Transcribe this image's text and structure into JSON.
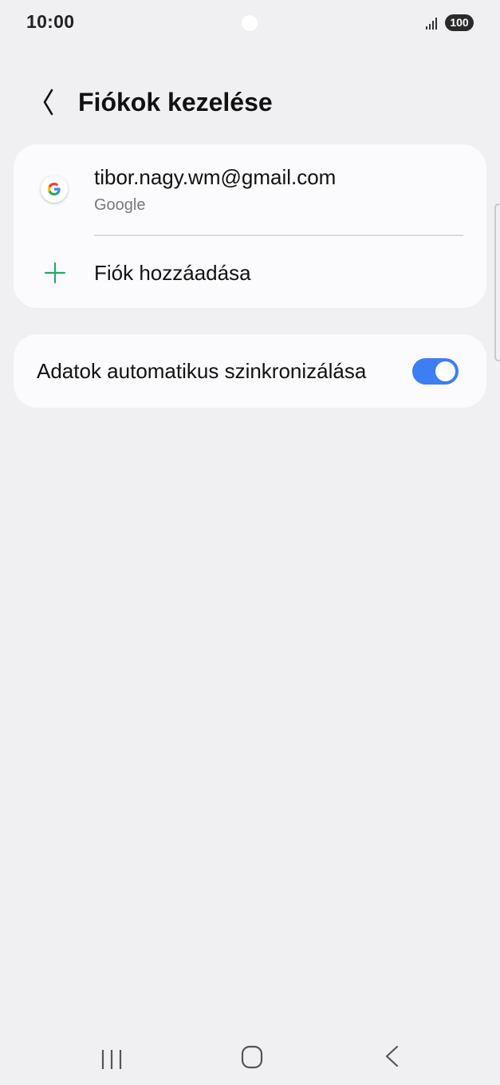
{
  "status_bar": {
    "time": "10:00",
    "battery": "100",
    "signal_icon": "signal-bars-icon"
  },
  "header": {
    "back_icon": "chevron-left-icon",
    "title": "Fiókok kezelése"
  },
  "accounts": {
    "items": [
      {
        "email": "tibor.nagy.wm@gmail.com",
        "type": "Google",
        "icon": "google-logo-icon"
      }
    ],
    "add_account_label": "Fiók hozzáadása",
    "add_icon": "plus-icon",
    "add_icon_color": "#2fa56a"
  },
  "sync": {
    "label": "Adatok automatikus szinkronizálása",
    "enabled": true,
    "toggle_color": "#3d7ef3"
  },
  "nav_bar": {
    "recents_icon": "recent-apps-icon",
    "home_icon": "home-icon",
    "back_icon": "back-icon"
  }
}
